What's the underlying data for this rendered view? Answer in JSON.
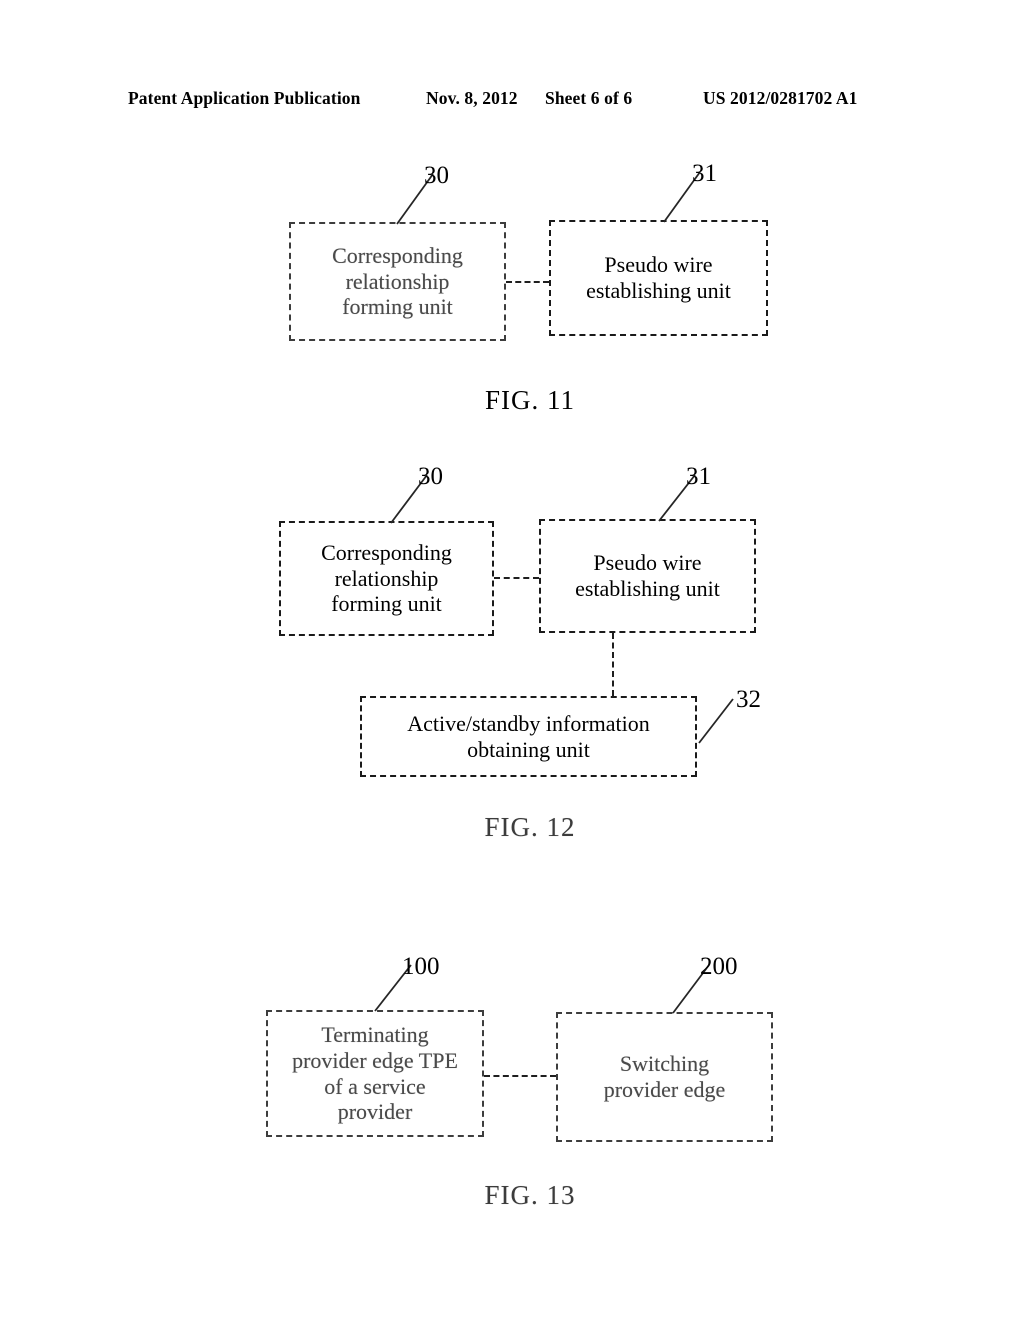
{
  "header": {
    "publication": "Patent Application Publication",
    "date": "Nov. 8, 2012",
    "sheet": "Sheet 6 of 6",
    "patent_number": "US 2012/0281702 A1"
  },
  "figures": [
    {
      "caption": "FIG. 11",
      "blocks": [
        {
          "ref": "30",
          "label": "Corresponding\nrelationship\nforming unit"
        },
        {
          "ref": "31",
          "label": "Pseudo wire\nestablishing unit"
        }
      ]
    },
    {
      "caption": "FIG. 12",
      "blocks": [
        {
          "ref": "30",
          "label": "Corresponding\nrelationship\nforming unit"
        },
        {
          "ref": "31",
          "label": "Pseudo wire\nestablishing unit"
        },
        {
          "ref": "32",
          "label": "Active/standby information\nobtaining unit"
        }
      ]
    },
    {
      "caption": "FIG. 13",
      "blocks": [
        {
          "ref": "100",
          "label": "Terminating\nprovider edge TPE\nof a service\nprovider"
        },
        {
          "ref": "200",
          "label": "Switching\nprovider edge"
        }
      ]
    }
  ],
  "colors": {
    "ink": "#000000",
    "paper": "#ffffff",
    "faded_ink": "#4a4a4a"
  }
}
